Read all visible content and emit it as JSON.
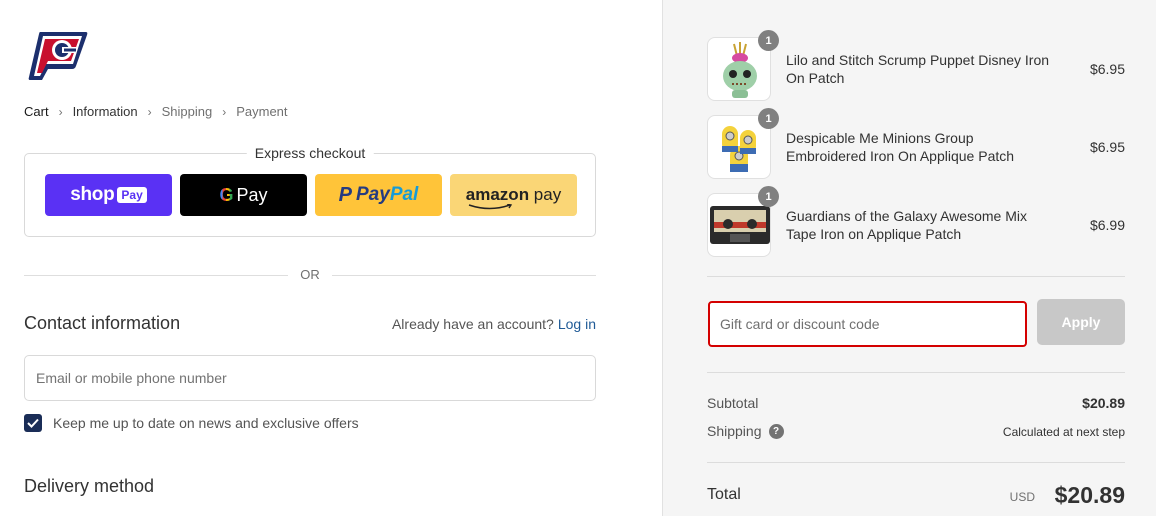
{
  "brand": {
    "name": "brand logo"
  },
  "breadcrumb": {
    "items": [
      "Cart",
      "Information",
      "Shipping",
      "Payment"
    ]
  },
  "express": {
    "title": "Express checkout",
    "shop_pay": {
      "word": "shop",
      "badge": "Pay"
    },
    "google_pay": {
      "letter": "G",
      "word": "Pay"
    },
    "paypal": {
      "mark": "P",
      "part1": "Pay",
      "part2": "Pal"
    },
    "amazon_pay": {
      "part1": "amazon",
      "part2": " pay"
    }
  },
  "divider": {
    "label": "OR"
  },
  "contact": {
    "title": "Contact information",
    "account_prompt": "Already have an account?",
    "login_link": "Log in",
    "email_placeholder": "Email or mobile phone number",
    "email_value": "",
    "newsletter_label": "Keep me up to date on news and exclusive offers",
    "newsletter_checked": true
  },
  "delivery": {
    "title": "Delivery method"
  },
  "cart": {
    "items": [
      {
        "name": "Lilo and Stitch Scrump Puppet Disney Iron On Patch",
        "price": "$6.95",
        "quantity": "1"
      },
      {
        "name": "Despicable Me Minions Group Embroidered Iron On Applique Patch",
        "price": "$6.95",
        "quantity": "1"
      },
      {
        "name": "Guardians of the Galaxy Awesome Mix Tape Iron on Applique Patch",
        "price": "$6.99",
        "quantity": "1"
      }
    ]
  },
  "discount": {
    "placeholder": "Gift card or discount code",
    "value": "",
    "apply_label": "Apply"
  },
  "summary": {
    "subtotal_label": "Subtotal",
    "subtotal_value": "$20.89",
    "shipping_label": "Shipping",
    "shipping_help_icon": "?",
    "shipping_value": "Calculated at next step",
    "total_label": "Total",
    "currency": "USD",
    "total_value": "$20.89"
  },
  "colors": {
    "shop_pay": "#5a31f4",
    "google_pay": "#000000",
    "paypal": "#ffc439",
    "amazon_pay": "#fad676",
    "link": "#1f5a96",
    "checkbox": "#1a2d57",
    "discount_border": "#d40000",
    "apply_disabled": "#c8c8c8"
  },
  "icons": {
    "breadcrumb_separator": "chevron-right-icon",
    "checkbox": "check-icon",
    "shipping_help": "question-circle-icon"
  }
}
